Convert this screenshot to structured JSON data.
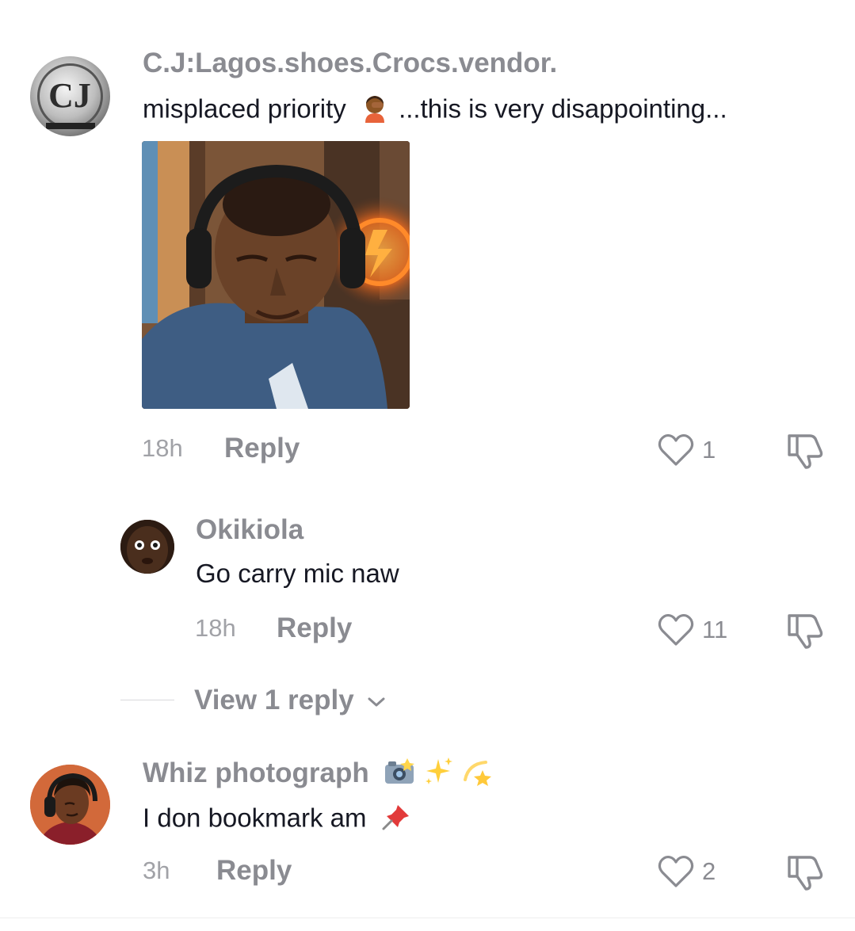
{
  "comments": [
    {
      "username": "C.J:Lagos.shoes.Crocs.vendor.",
      "text_before": "misplaced priority",
      "text_after": "...this is very disappointing...",
      "emoji": "facepalm-emoji",
      "has_image": true,
      "time": "18h",
      "reply_label": "Reply",
      "likes": "1"
    },
    {
      "username": "Okikiola",
      "text": "Go carry mic naw",
      "time": "18h",
      "reply_label": "Reply",
      "likes": "11"
    },
    {
      "username": "Whiz photograph",
      "username_emojis": [
        "camera-flash-emoji",
        "sparkles-emoji",
        "dizzy-emoji"
      ],
      "text": "I don bookmark am",
      "text_emoji": "pushpin-emoji",
      "time": "3h",
      "reply_label": "Reply",
      "likes": "2"
    }
  ],
  "view_replies": {
    "label": "View 1 reply"
  },
  "icons": {
    "like": "heart-outline-icon",
    "dislike": "thumbs-down-outline-icon",
    "chevron": "chevron-down-icon"
  },
  "colors": {
    "username": "#8a8b91",
    "text": "#161823",
    "meta": "#a1a2a7"
  }
}
